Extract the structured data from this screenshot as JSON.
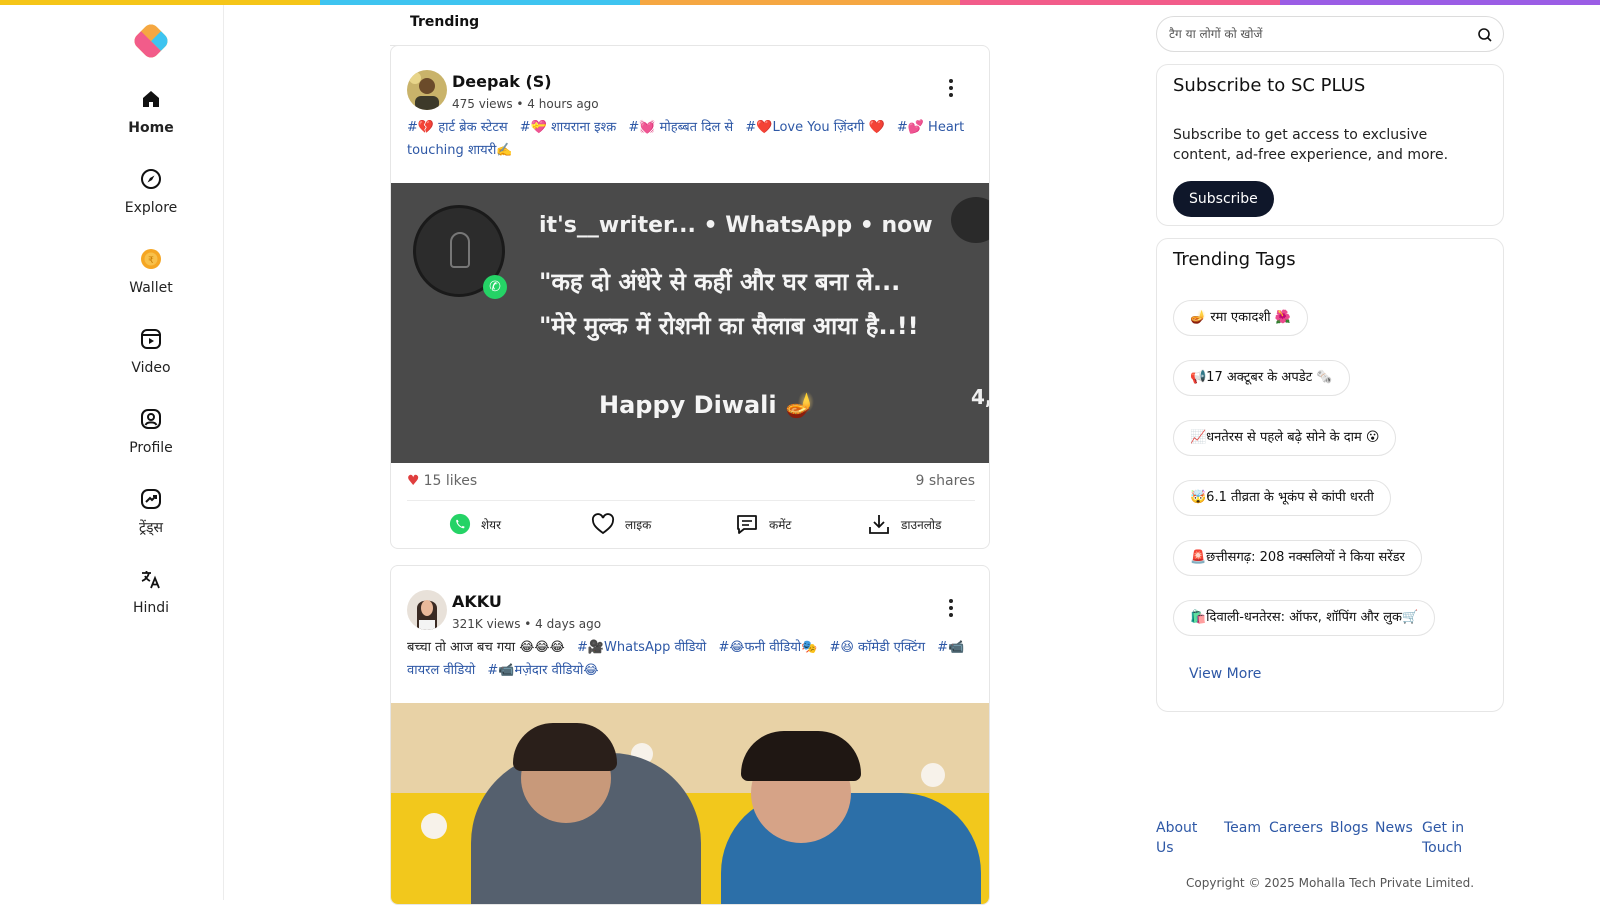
{
  "brand": {
    "stripe_colors": [
      "#f5c518",
      "#3ec4f0",
      "#f5a742",
      "#f25c8a",
      "#9b5de5"
    ]
  },
  "nav": {
    "items": [
      {
        "label": "Home",
        "icon": "home-icon"
      },
      {
        "label": "Explore",
        "icon": "compass-icon"
      },
      {
        "label": "Wallet",
        "icon": "coin-icon"
      },
      {
        "label": "Video",
        "icon": "video-icon"
      },
      {
        "label": "Profile",
        "icon": "profile-icon"
      },
      {
        "label": "ट्रेंड्स",
        "icon": "trending-icon"
      },
      {
        "label": "Hindi",
        "icon": "translate-icon"
      }
    ]
  },
  "feed": {
    "tab": "Trending",
    "posts": [
      {
        "author": "Deepak (S)",
        "meta": "475 views • 4 hours ago",
        "tags": [
          "#💔 हार्ट ब्रेक स्टेटस",
          "#💝 शायराना इश्क़",
          "#💓 मोहब्बत दिल से",
          "#❤️Love You ज़िंदगी ❤️",
          "#💕 Heart touching शायरी✍️"
        ],
        "image": {
          "header": "it's__writer... • WhatsApp • now",
          "line1": "\"कह दो अंधेरे से कहीं और घर बना ले...",
          "line2": "\"मेरे मुल्क में रोशनी का सैलाब आया है..!!",
          "line3": "Happy Diwali 🪔",
          "side": "4,"
        },
        "likes": "15 likes",
        "shares": "9 shares"
      },
      {
        "author": "AKKU",
        "meta": "321K views • 4 days ago",
        "caption": "बच्चा तो आज बच गया 😂😂😂",
        "tags": [
          "#🎥WhatsApp वीडियो",
          "#😂फनी वीडियो🎭",
          "#😆 कॉमेडी एक्टिंग",
          "#📹 वायरल वीडियो",
          "#📹मज़ेदार वीडियो😂"
        ]
      }
    ],
    "actions": {
      "share": "शेयर",
      "like": "लाइक",
      "comment": "कमेंट",
      "download": "डाउनलोड"
    }
  },
  "search": {
    "placeholder": "टैग या लोगों को खोजें"
  },
  "subscribe": {
    "title": "Subscribe to SC PLUS",
    "description": "Subscribe to get access to exclusive content, ad-free experience, and more.",
    "button": "Subscribe"
  },
  "trending_tags": {
    "title": "Trending Tags",
    "items": [
      "🪔 रमा एकादशी 🌺",
      "📢17 अक्टूबर के अपडेट 🗞️",
      "📈धनतेरस से पहले बढ़े सोने के दाम 😮",
      "🤯6.1 तीव्रता के भूकंप से कांपी धरती",
      "🚨छत्तीसगढ़: 208 नक्सलियों ने किया सरेंडर",
      "🛍️दिवाली-धनतेरस: ऑफर, शॉपिंग और लुक🛒"
    ],
    "view_more": "View More"
  },
  "footer": {
    "links": [
      "About Us",
      "Team",
      "Careers",
      "Blogs",
      "News",
      "Get in Touch"
    ],
    "copyright": "Copyright © 2025 Mohalla Tech Private Limited."
  }
}
